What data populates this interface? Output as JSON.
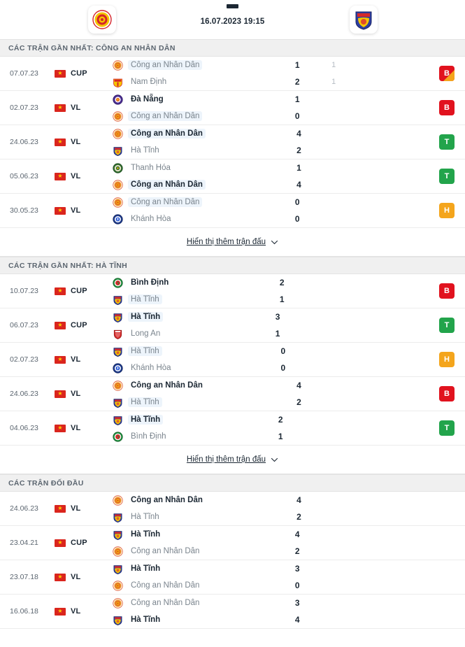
{
  "header": {
    "home_team": "Công an Nhân Dân",
    "away_team": "Hà Tĩnh",
    "home_crest": "cand-crest-icon",
    "away_crest": "hatinh-crest-icon",
    "score_separator": "-",
    "datetime": "16.07.2023 19:15"
  },
  "show_more_label": "Hiển thị thêm trận đấu",
  "colors": {
    "win": "#22a44b",
    "loss": "#e1121e",
    "draw": "#f4a51c",
    "highlight": "#edf4fb",
    "section_bg": "#f0f0f0"
  },
  "sections": [
    {
      "title": "CÁC TRẬN GẦN NHẤT: CÔNG AN NHÂN DÂN",
      "has_show_more": true,
      "rows": [
        {
          "date": "07.07.23",
          "flag": "vietnam-flag-icon",
          "competition": "CUP",
          "home": {
            "name": "Công an Nhân Dân",
            "crest": "cand-crest-icon",
            "bold": false,
            "highlight": true
          },
          "away": {
            "name": "Nam Định",
            "crest": "namdinh-crest-icon",
            "bold": false,
            "highlight": false
          },
          "home_score": "1",
          "away_score": "2",
          "home_pens": "1",
          "away_pens": "1",
          "badge": {
            "letter": "B",
            "result": "L",
            "penalty_corner": true
          }
        },
        {
          "date": "02.07.23",
          "flag": "vietnam-flag-icon",
          "competition": "VL",
          "home": {
            "name": "Đà Nẵng",
            "crest": "danang-crest-icon",
            "bold": true,
            "highlight": false
          },
          "away": {
            "name": "Công an Nhân Dân",
            "crest": "cand-crest-icon",
            "bold": false,
            "highlight": true
          },
          "home_score": "1",
          "away_score": "0",
          "home_pens": "",
          "away_pens": "",
          "badge": {
            "letter": "B",
            "result": "L",
            "penalty_corner": false
          }
        },
        {
          "date": "24.06.23",
          "flag": "vietnam-flag-icon",
          "competition": "VL",
          "home": {
            "name": "Công an Nhân Dân",
            "crest": "cand-crest-icon",
            "bold": true,
            "highlight": true
          },
          "away": {
            "name": "Hà Tĩnh",
            "crest": "hatinh-crest-icon",
            "bold": false,
            "highlight": false
          },
          "home_score": "4",
          "away_score": "2",
          "home_pens": "",
          "away_pens": "",
          "badge": {
            "letter": "T",
            "result": "W",
            "penalty_corner": false
          }
        },
        {
          "date": "05.06.23",
          "flag": "vietnam-flag-icon",
          "competition": "VL",
          "home": {
            "name": "Thanh Hóa",
            "crest": "thanhhoa-crest-icon",
            "bold": false,
            "highlight": false
          },
          "away": {
            "name": "Công an Nhân Dân",
            "crest": "cand-crest-icon",
            "bold": true,
            "highlight": true
          },
          "home_score": "1",
          "away_score": "4",
          "home_pens": "",
          "away_pens": "",
          "badge": {
            "letter": "T",
            "result": "W",
            "penalty_corner": false
          }
        },
        {
          "date": "30.05.23",
          "flag": "vietnam-flag-icon",
          "competition": "VL",
          "home": {
            "name": "Công an Nhân Dân",
            "crest": "cand-crest-icon",
            "bold": false,
            "highlight": true
          },
          "away": {
            "name": "Khánh Hòa",
            "crest": "khanhhoa-crest-icon",
            "bold": false,
            "highlight": false
          },
          "home_score": "0",
          "away_score": "0",
          "home_pens": "",
          "away_pens": "",
          "badge": {
            "letter": "H",
            "result": "D",
            "penalty_corner": false
          }
        }
      ]
    },
    {
      "title": "CÁC TRẬN GẦN NHẤT: HÀ TĨNH",
      "has_show_more": true,
      "rows": [
        {
          "date": "10.07.23",
          "flag": "vietnam-flag-icon",
          "competition": "CUP",
          "home": {
            "name": "Bình Định",
            "crest": "binhdinh-crest-icon",
            "bold": true,
            "highlight": false
          },
          "away": {
            "name": "Hà Tĩnh",
            "crest": "hatinh-crest-icon",
            "bold": false,
            "highlight": true
          },
          "home_score": "2",
          "away_score": "1",
          "home_pens": "",
          "away_pens": "",
          "badge": {
            "letter": "B",
            "result": "L",
            "penalty_corner": false
          }
        },
        {
          "date": "06.07.23",
          "flag": "vietnam-flag-icon",
          "competition": "CUP",
          "home": {
            "name": "Hà Tĩnh",
            "crest": "hatinh-crest-icon",
            "bold": true,
            "highlight": true
          },
          "away": {
            "name": "Long An",
            "crest": "longan-crest-icon",
            "bold": false,
            "highlight": false
          },
          "home_score": "3",
          "away_score": "1",
          "home_pens": "",
          "away_pens": "",
          "badge": {
            "letter": "T",
            "result": "W",
            "penalty_corner": false
          }
        },
        {
          "date": "02.07.23",
          "flag": "vietnam-flag-icon",
          "competition": "VL",
          "home": {
            "name": "Hà Tĩnh",
            "crest": "hatinh-crest-icon",
            "bold": false,
            "highlight": true
          },
          "away": {
            "name": "Khánh Hòa",
            "crest": "khanhhoa-crest-icon",
            "bold": false,
            "highlight": false
          },
          "home_score": "0",
          "away_score": "0",
          "home_pens": "",
          "away_pens": "",
          "badge": {
            "letter": "H",
            "result": "D",
            "penalty_corner": false
          }
        },
        {
          "date": "24.06.23",
          "flag": "vietnam-flag-icon",
          "competition": "VL",
          "home": {
            "name": "Công an Nhân Dân",
            "crest": "cand-crest-icon",
            "bold": true,
            "highlight": false
          },
          "away": {
            "name": "Hà Tĩnh",
            "crest": "hatinh-crest-icon",
            "bold": false,
            "highlight": true
          },
          "home_score": "4",
          "away_score": "2",
          "home_pens": "",
          "away_pens": "",
          "badge": {
            "letter": "B",
            "result": "L",
            "penalty_corner": false
          }
        },
        {
          "date": "04.06.23",
          "flag": "vietnam-flag-icon",
          "competition": "VL",
          "home": {
            "name": "Hà Tĩnh",
            "crest": "hatinh-crest-icon",
            "bold": true,
            "highlight": true
          },
          "away": {
            "name": "Bình Định",
            "crest": "binhdinh-crest-icon",
            "bold": false,
            "highlight": false
          },
          "home_score": "2",
          "away_score": "1",
          "home_pens": "",
          "away_pens": "",
          "badge": {
            "letter": "T",
            "result": "W",
            "penalty_corner": false
          }
        }
      ]
    },
    {
      "title": "CÁC TRẬN ĐỐI ĐẦU",
      "has_show_more": false,
      "rows": [
        {
          "date": "24.06.23",
          "flag": "vietnam-flag-icon",
          "competition": "VL",
          "home": {
            "name": "Công an Nhân Dân",
            "crest": "cand-crest-icon",
            "bold": true,
            "highlight": false
          },
          "away": {
            "name": "Hà Tĩnh",
            "crest": "hatinh-crest-icon",
            "bold": false,
            "highlight": false
          },
          "home_score": "4",
          "away_score": "2",
          "home_pens": "",
          "away_pens": "",
          "badge": null
        },
        {
          "date": "23.04.21",
          "flag": "vietnam-flag-icon",
          "competition": "CUP",
          "home": {
            "name": "Hà Tĩnh",
            "crest": "hatinh-crest-icon",
            "bold": true,
            "highlight": false
          },
          "away": {
            "name": "Công an Nhân Dân",
            "crest": "cand-crest-icon",
            "bold": false,
            "highlight": false
          },
          "home_score": "4",
          "away_score": "2",
          "home_pens": "",
          "away_pens": "",
          "badge": null
        },
        {
          "date": "23.07.18",
          "flag": "vietnam-flag-icon",
          "competition": "VL",
          "home": {
            "name": "Hà Tĩnh",
            "crest": "hatinh-crest-icon",
            "bold": true,
            "highlight": false
          },
          "away": {
            "name": "Công an Nhân Dân",
            "crest": "cand-crest-icon",
            "bold": false,
            "highlight": false
          },
          "home_score": "3",
          "away_score": "0",
          "home_pens": "",
          "away_pens": "",
          "badge": null
        },
        {
          "date": "16.06.18",
          "flag": "vietnam-flag-icon",
          "competition": "VL",
          "home": {
            "name": "Công an Nhân Dân",
            "crest": "cand-crest-icon",
            "bold": false,
            "highlight": false
          },
          "away": {
            "name": "Hà Tĩnh",
            "crest": "hatinh-crest-icon",
            "bold": true,
            "highlight": false
          },
          "home_score": "3",
          "away_score": "4",
          "home_pens": "",
          "away_pens": "",
          "badge": null
        }
      ]
    }
  ]
}
